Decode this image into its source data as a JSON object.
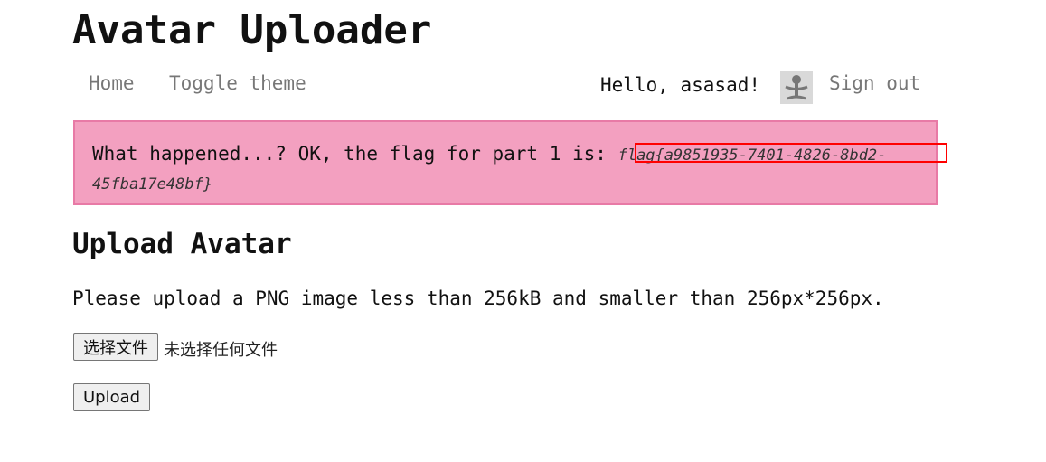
{
  "app": {
    "title": "Avatar Uploader"
  },
  "nav": {
    "home": "Home",
    "toggle_theme": "Toggle theme",
    "greeting": "Hello, asasad!",
    "sign_out": "Sign out",
    "avatar_icon": "stick-figure-avatar"
  },
  "alert": {
    "message": "What happened...? OK, the flag for part 1 is: ",
    "flag": "flag{a9851935-7401-4826-8bd2-45fba17e48bf}",
    "highlight_color": "#ff0000",
    "background_color": "#f3a0c0"
  },
  "upload": {
    "title": "Upload Avatar",
    "instructions": "Please upload a PNG image less than 256kB and smaller than 256px*256px.",
    "choose_file_label": "选择文件",
    "no_file_text": "未选择任何文件",
    "upload_label": "Upload"
  }
}
